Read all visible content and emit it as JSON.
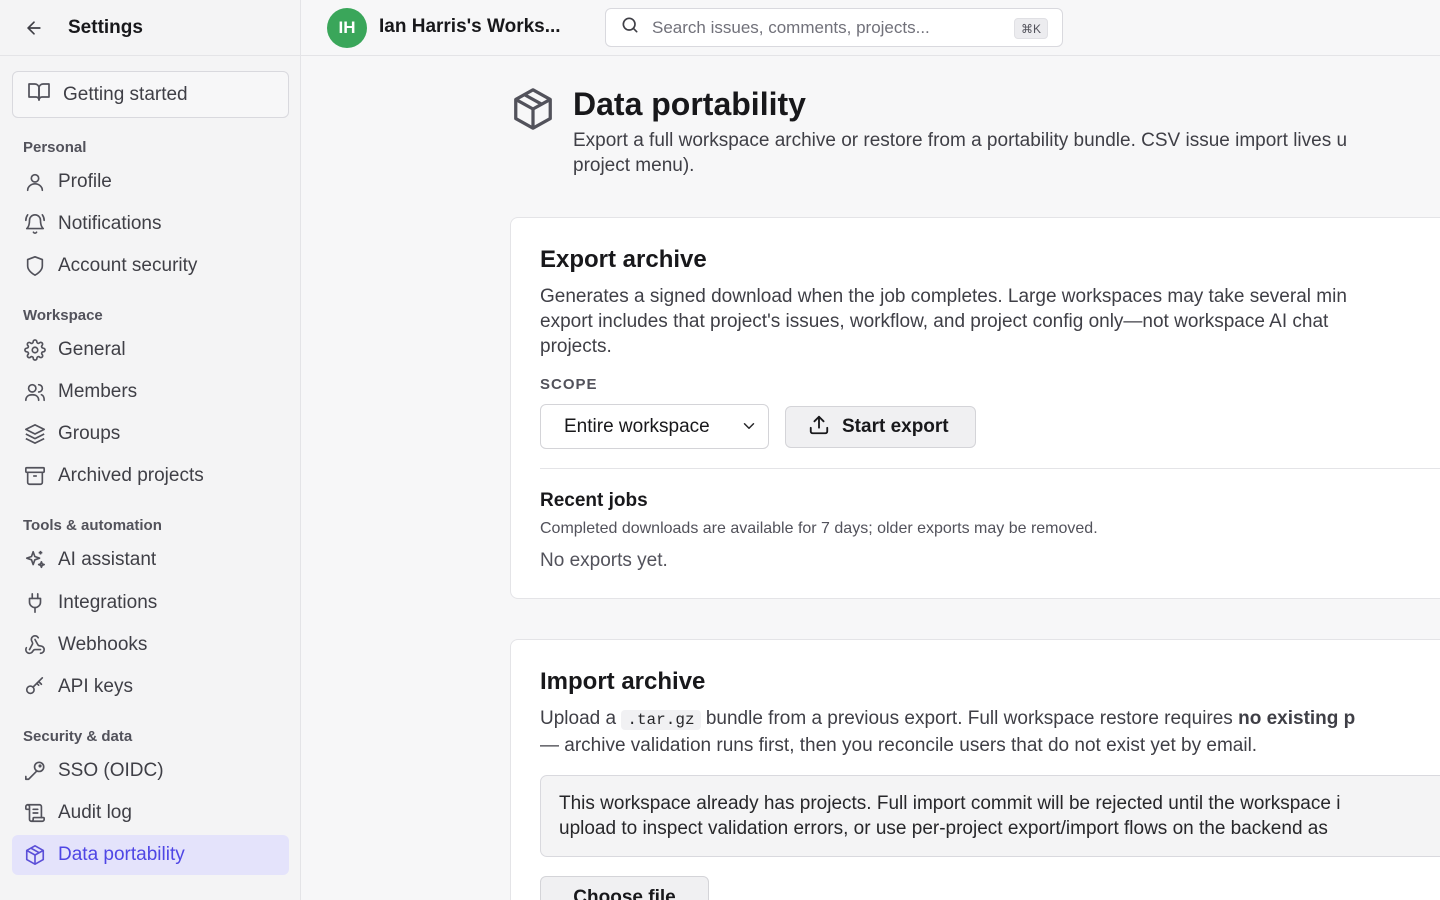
{
  "sidebar": {
    "title": "Settings",
    "getting_started": "Getting started",
    "sections": {
      "personal": "Personal",
      "workspace": "Workspace",
      "tools": "Tools & automation",
      "security": "Security & data"
    },
    "items": {
      "profile": "Profile",
      "notifications": "Notifications",
      "account_security": "Account security",
      "general": "General",
      "members": "Members",
      "groups": "Groups",
      "archived_projects": "Archived projects",
      "ai_assistant": "AI assistant",
      "integrations": "Integrations",
      "webhooks": "Webhooks",
      "api_keys": "API keys",
      "sso": "SSO (OIDC)",
      "audit_log": "Audit log",
      "data_portability": "Data portability"
    },
    "active_item": "data_portability",
    "accent_color": "#4f46e5"
  },
  "topbar": {
    "avatar_initials": "IH",
    "avatar_color": "#3aa65a",
    "workspace_name": "Ian Harris's Works...",
    "search_placeholder": "Search issues, comments, projects...",
    "search_shortcut": "⌘K"
  },
  "page": {
    "title": "Data portability",
    "description": "Export a full workspace archive or restore from a portability bundle. CSV issue import lives u project menu).",
    "description_line1": "Export a full workspace archive or restore from a portability bundle. CSV issue import lives u",
    "description_line2": "project menu)."
  },
  "export": {
    "title": "Export archive",
    "desc_line1": "Generates a signed download when the job completes. Large workspaces may take several min",
    "desc_line2": "export includes that project's issues, workflow, and project config only—not workspace AI chat",
    "desc_line3": "projects.",
    "scope_label": "SCOPE",
    "scope_value": "Entire workspace",
    "start_button": "Start export",
    "recent_jobs_title": "Recent jobs",
    "recent_jobs_subtitle": "Completed downloads are available for 7 days; older exports may be removed.",
    "recent_jobs_empty": "No exports yet."
  },
  "import": {
    "title": "Import archive",
    "desc_prefix": "Upload a",
    "desc_code": ".tar.gz",
    "desc_mid": "bundle from a previous export. Full workspace restore requires",
    "desc_bold": "no existing p",
    "desc_line2": "— archive validation runs first, then you reconcile users that do not exist yet by email.",
    "notice_line1": "This workspace already has projects. Full import commit will be rejected until the workspace i",
    "notice_line2": "upload to inspect validation errors, or use per-project export/import flows on the backend as",
    "choose_file": "Choose file"
  }
}
